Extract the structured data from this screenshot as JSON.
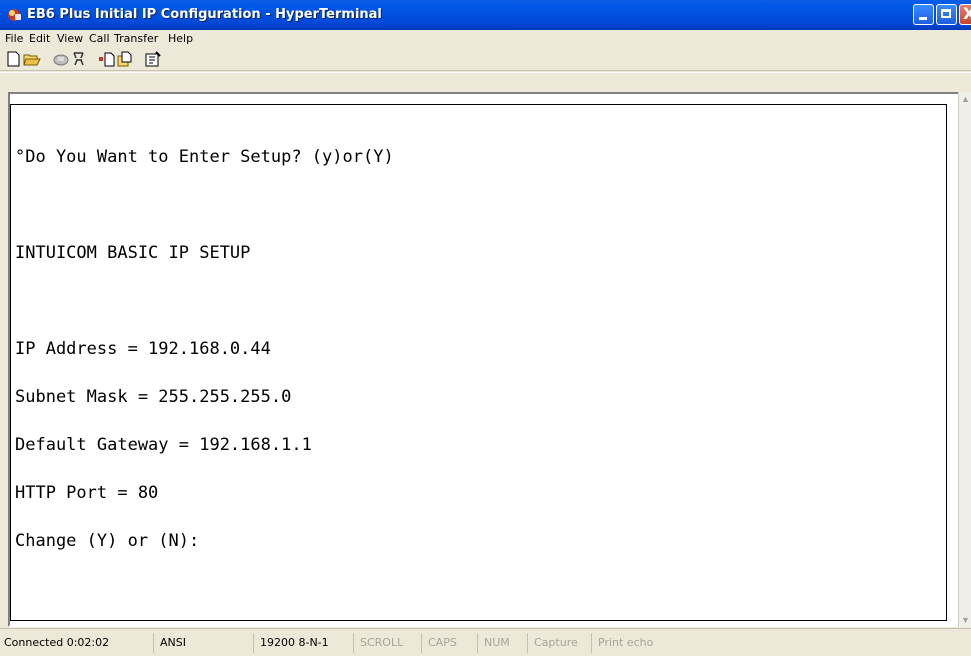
{
  "window": {
    "title": "EB6 Plus Initial IP Configuration - HyperTerminal",
    "controls": {
      "minimize_icon": "minimize-icon",
      "maximize_icon": "maximize-icon",
      "close_icon": "close-icon",
      "close_glyph": "X"
    }
  },
  "menu": [
    "File",
    "Edit",
    "View",
    "Call",
    "Transfer",
    "Help"
  ],
  "toolbar": {
    "icons": [
      "new-file-icon",
      "open-folder-icon",
      "call-icon",
      "disconnect-icon",
      "send-icon",
      "receive-icon",
      "properties-icon"
    ]
  },
  "terminal": {
    "lines": [
      "°Do You Want to Enter Setup? (y)or(Y)",
      "",
      "INTUICOM BASIC IP SETUP",
      "",
      "IP Address = 192.168.0.44",
      "Subnet Mask = 255.255.255.0",
      "Default Gateway = 192.168.1.1",
      "HTTP Port = 80",
      "Change (Y) or (N):"
    ]
  },
  "status": {
    "connected": "Connected 0:02:02",
    "emulation": "ANSI",
    "port_settings": "19200 8-N-1",
    "scroll": "SCROLL",
    "caps": "CAPS",
    "num": "NUM",
    "capture": "Capture",
    "print_echo": "Print echo"
  },
  "colors": {
    "titlebar": "#0058e6",
    "chrome": "#ece9d8",
    "terminal_bg": "#ffffff",
    "terminal_text": "#000000",
    "close_button": "#c8452b"
  }
}
